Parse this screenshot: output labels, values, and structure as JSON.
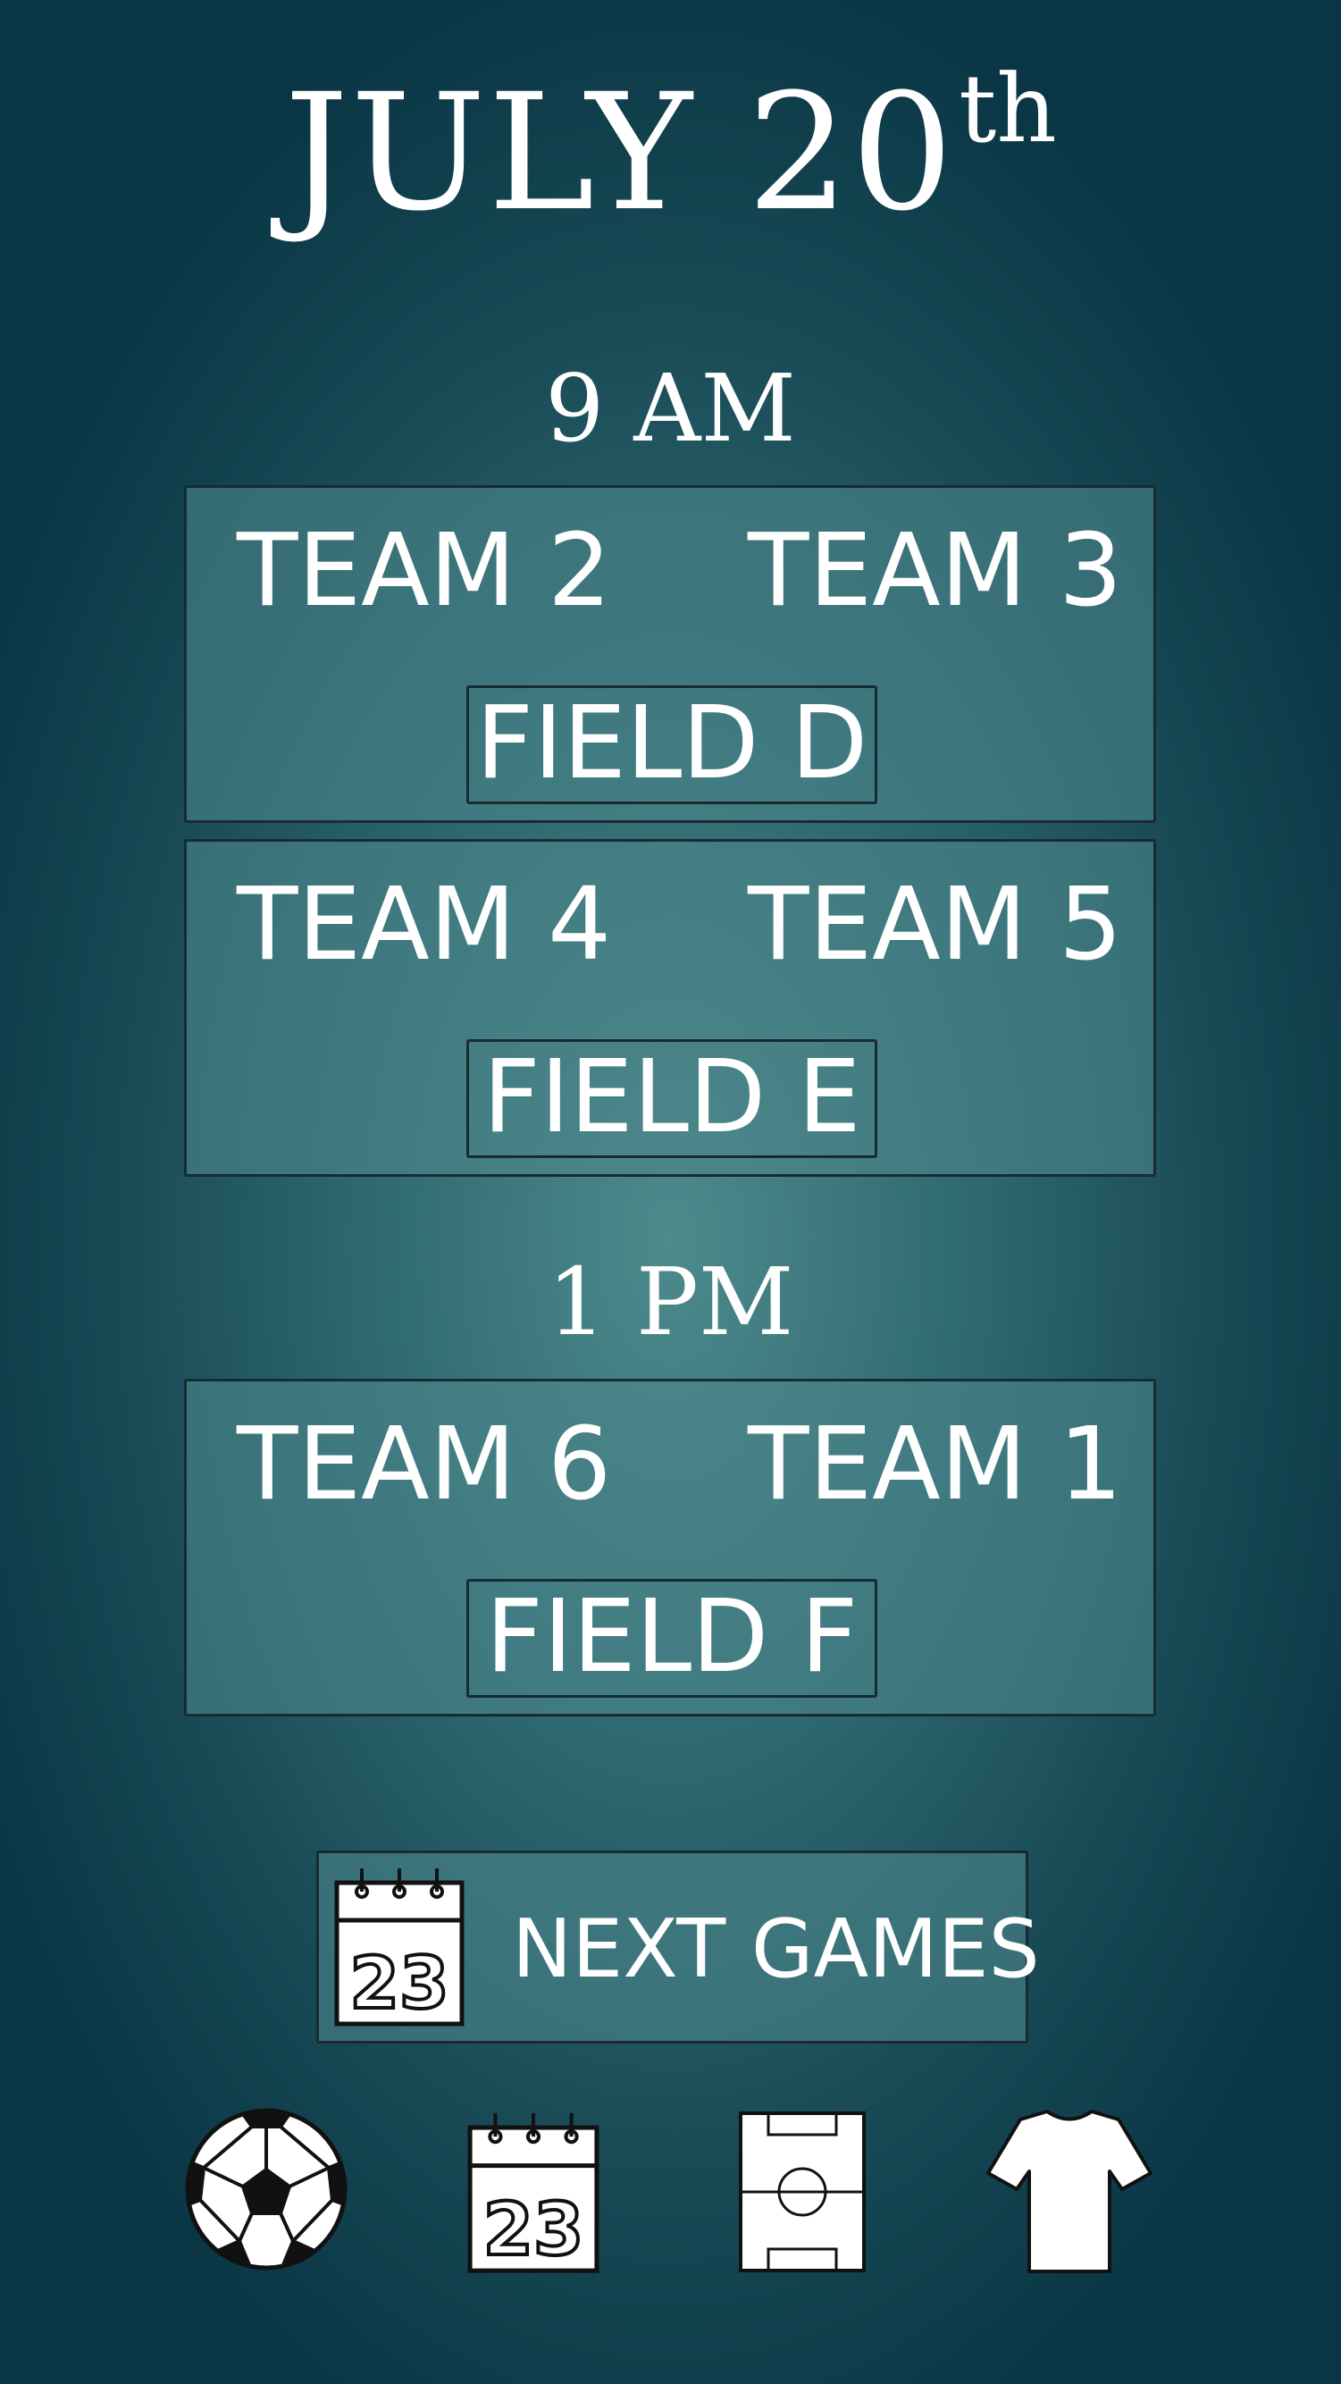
{
  "header": {
    "month_day": "JULY 20",
    "suffix": "th"
  },
  "schedule": {
    "slot1": {
      "time": "9 AM",
      "match1": {
        "team_a": "TEAM 2",
        "team_b": "TEAM 3",
        "field": "FIELD D"
      },
      "match2": {
        "team_a": "TEAM 4",
        "team_b": "TEAM 5",
        "field": "FIELD E"
      }
    },
    "slot2": {
      "time": "1 PM",
      "match1": {
        "team_a": "TEAM 6",
        "team_b": "TEAM 1",
        "field": "FIELD F"
      }
    }
  },
  "next_games": {
    "label": "NEXT GAMES",
    "icon": "calendar-icon",
    "calendar_number": "23"
  },
  "nav": {
    "items": [
      {
        "icon": "soccer-ball-icon"
      },
      {
        "icon": "calendar-icon",
        "calendar_number": "23"
      },
      {
        "icon": "soccer-field-icon"
      },
      {
        "icon": "jersey-icon"
      }
    ]
  },
  "colors": {
    "background_center": "#4d8a8c",
    "background_edge": "#093544",
    "card_fill": "#4c868a",
    "border": "#1a2a30",
    "text": "#ffffff"
  }
}
